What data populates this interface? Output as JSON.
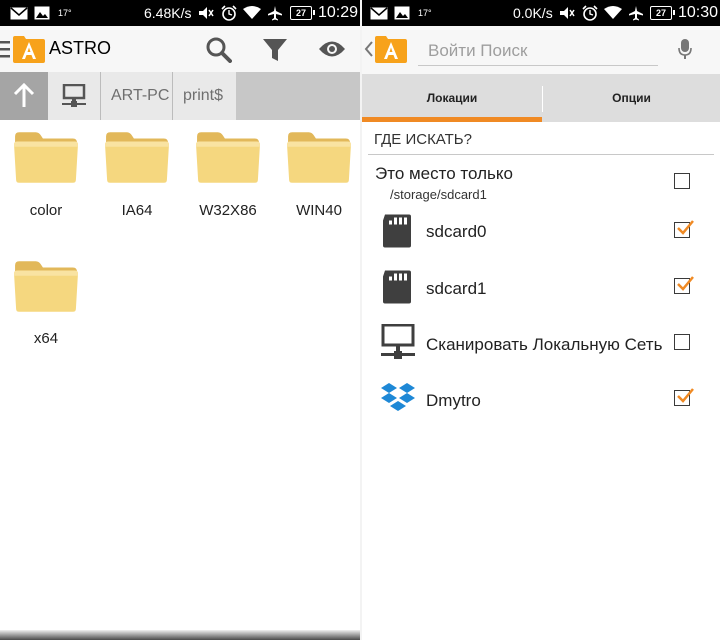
{
  "left": {
    "status": {
      "speed": "6.48K/s",
      "temp": "17°",
      "battery": "27",
      "time": "10:29"
    },
    "app_title": "ASTRO",
    "breadcrumbs": [
      "ART-PC",
      "print$"
    ],
    "folders": [
      "color",
      "IA64",
      "W32X86",
      "WIN40",
      "x64"
    ]
  },
  "right": {
    "status": {
      "speed": "0.0K/s",
      "temp": "17°",
      "battery": "27",
      "time": "10:30"
    },
    "search_placeholder": "Войти Поиск",
    "tabs": [
      "Локации",
      "Опции"
    ],
    "section_title": "ГДЕ ИСКАТЬ?",
    "this_place": {
      "label": "Это место только",
      "path": "/storage/sdcard1",
      "checked": false
    },
    "locations": [
      {
        "label": "sdcard0",
        "icon": "sdcard-icon",
        "checked": true
      },
      {
        "label": "sdcard1",
        "icon": "sdcard-icon",
        "checked": true
      },
      {
        "label": "Сканировать Локальную Сеть",
        "icon": "network-icon",
        "checked": false
      },
      {
        "label": "Dmytro",
        "icon": "dropbox-icon",
        "checked": true
      }
    ]
  },
  "colors": {
    "accent": "#f08a24",
    "folder": "#f3d37c",
    "dropbox": "#1e88d6"
  }
}
